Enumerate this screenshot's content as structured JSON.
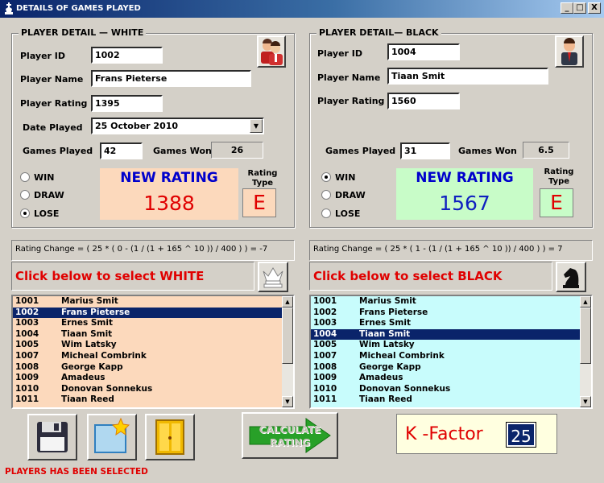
{
  "window": {
    "title": "DETAILS OF GAMES PLAYED",
    "controls": {
      "minimize": "_",
      "maximize": "□",
      "close": "X"
    }
  },
  "white": {
    "legend": "PLAYER DETAIL  — WHITE",
    "player_id_label": "Player ID",
    "player_id": "1002",
    "player_name_label": "Player Name",
    "player_name": "Frans Pieterse",
    "player_rating_label": "Player Rating",
    "player_rating": "1395",
    "date_played_label": "Date Played",
    "date_played": "25   October   2010",
    "games_played_label": "Games Played",
    "games_played": "42",
    "games_won_label": "Games Won",
    "games_won": "26",
    "result_options": [
      "WIN",
      "DRAW",
      "LOSE"
    ],
    "selected_result": "LOSE",
    "new_rating_label": "NEW RATING",
    "new_rating": "1388",
    "rating_type_label": "Rating Type",
    "rating_type": "E",
    "rating_change": "Rating Change = ( 25 *  ( 0 -  (1 / (1 + 165 ^ 10 ))  / 400  ) ) = -7",
    "select_prompt": "Click below to select WHITE"
  },
  "black": {
    "legend": "PLAYER DETAIL— BLACK",
    "player_id_label": "Player ID",
    "player_id": "1004",
    "player_name_label": "Player Name",
    "player_name": "Tiaan Smit",
    "player_rating_label": "Player Rating",
    "player_rating": "1560",
    "games_played_label": "Games Played",
    "games_played": "31",
    "games_won_label": "Games Won",
    "games_won": "6.5",
    "result_options": [
      "WIN",
      "DRAW",
      "LOSE"
    ],
    "selected_result": "WIN",
    "new_rating_label": "NEW RATING",
    "new_rating": "1567",
    "rating_type_label": "Rating Type",
    "rating_type": "E",
    "rating_change": "Rating Change = ( 25 *  ( 1 -  (1 / (1 + 165 ^ 10 ))  / 400  ) ) = 7",
    "select_prompt": "Click below to select BLACK"
  },
  "players": [
    {
      "id": "1001",
      "name": "Marius Smit"
    },
    {
      "id": "1002",
      "name": "Frans Pieterse"
    },
    {
      "id": "1003",
      "name": "Ernes Smit"
    },
    {
      "id": "1004",
      "name": "Tiaan Smit"
    },
    {
      "id": "1005",
      "name": "Wim Latsky"
    },
    {
      "id": "1007",
      "name": "Micheal Combrink"
    },
    {
      "id": "1008",
      "name": "George Kapp"
    },
    {
      "id": "1009",
      "name": "Amadeus"
    },
    {
      "id": "1010",
      "name": "Donovan Sonnekus"
    },
    {
      "id": "1011",
      "name": "Tiaan Reed"
    }
  ],
  "white_selected_index": 1,
  "black_selected_index": 3,
  "calculate_label": "CALCULATE RATING",
  "k_factor_label": "K -Factor",
  "k_factor": "25",
  "status": "PLAYERS HAS BEEN SELECTED",
  "colors": {
    "white_panel": "#fcd9bc",
    "black_panel": "#c8fcfc",
    "new_rating_white": "#e00000",
    "new_rating_black": "#1020c0",
    "alert_red": "#e00000",
    "selection": "#0a246a"
  }
}
